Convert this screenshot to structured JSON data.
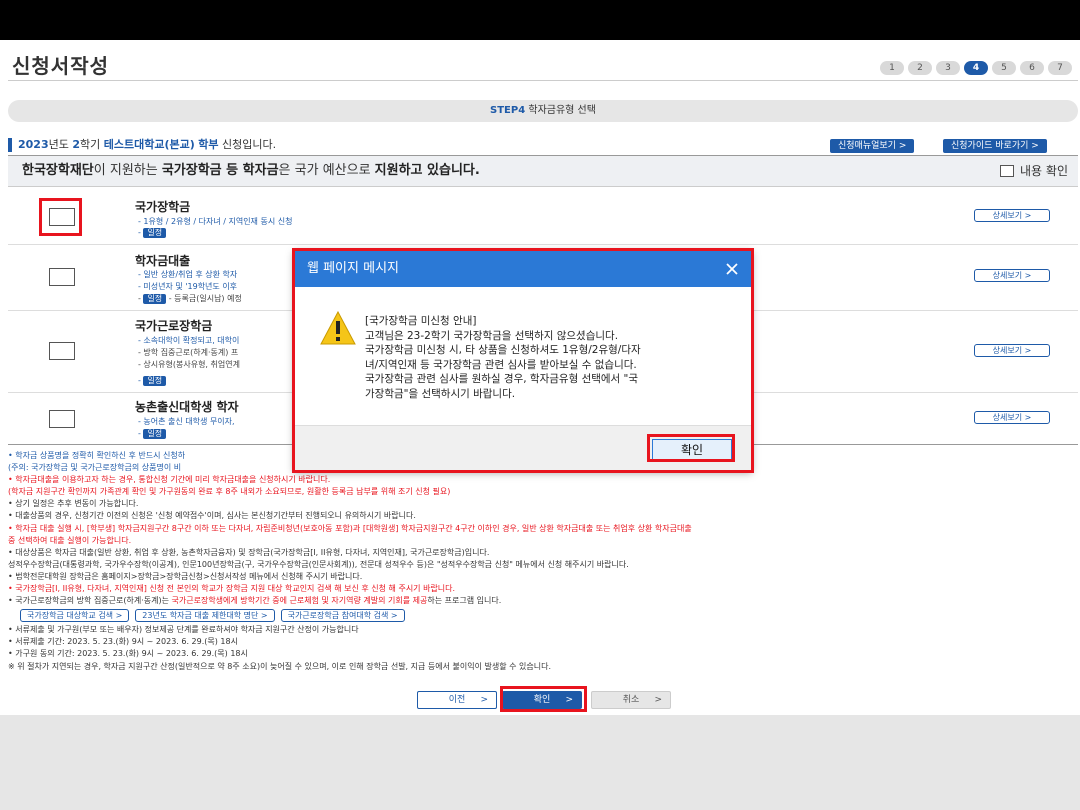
{
  "page": {
    "title": "신청서작성",
    "steps": [
      "1",
      "2",
      "3",
      "4",
      "5",
      "6",
      "7"
    ],
    "active_step": "4",
    "step_bar": {
      "step": "STEP4",
      "label": "학자금유형 선택"
    }
  },
  "school_line": {
    "year": "2023",
    "year_suffix": "년도",
    "semester": "2",
    "semester_suffix": "학기",
    "school": "테스트대학교(본교)",
    "degree": "학부",
    "suffix": "신청입니다."
  },
  "top_buttons": {
    "manual": "신청매뉴얼보기 >",
    "guide": "신청가이드 바로가기 >"
  },
  "notice": {
    "p1": "한국장학재단",
    "p2": "이 지원하는 ",
    "p3": "국가장학금 등 학자금",
    "p4": "은 국가 예산으로 ",
    "p5": "지원하고 있습니다.",
    "check_label": "내용 확인"
  },
  "rows": [
    {
      "title": "국가장학금",
      "sub1": "- 1유형 / 2유형 / 다자녀 / 지역인재 동시 신청",
      "badge": "일정",
      "detail": "상세보기 >"
    },
    {
      "title": "학자금대출",
      "sub1": "- 일반 상환/취업 후 상환 학자",
      "sub2": "- 미성년자 및 '19학년도 이후",
      "badge": "일정",
      "sub3": "- 등록금(일시납) 예정",
      "detail": "상세보기 >"
    },
    {
      "title": "국가근로장학금",
      "sub1": "- 소속대학이 확정되고, 대학이",
      "sub2": "- 방학 집중근로(하계·동계) 프",
      "sub3": "- 상시유형(봉사유형, 취업연계",
      "badge": "일정",
      "detail": "상세보기 >"
    },
    {
      "title": "농촌출신대학생 학자",
      "sub1": "- 농어촌 출신 대학생 무이자,",
      "badge": "일정",
      "detail": "상세보기 >"
    }
  ],
  "notes": {
    "n1": "• 학자금 상품명을 정확히 확인하신 후 반드시 신청하",
    "n2": "(주의: 국가장학금 및 국가근로장학금의 상품명이 비",
    "n3": "• 학자금대출을 이용하고자 하는 경우, 통합신청 기간에 미리 학자금대출을 신청하시기 바랍니다.",
    "n4": "(학자금 지원구간 확인까지 가족관계 확인 및 가구원동의 완료 후 8주 내외가 소요되므로, 원활한 등록금 납부를 위해 조기 신청 필요)",
    "n5": "• 상기 일정은 추후 변동이 가능합니다.",
    "n6": "• 대출상품의 경우, 신청기간 이전의 신청은 '신청 예약접수'이며, 심사는 본신청기간부터 진행되오니 유의하시기 바랍니다.",
    "n7": "• 학자금 대출 실행 시, [학부생] 학자금지원구간 8구간 이하 또는 다자녀, 자립준비청년(보호아동 포함)과 [대학원생] 학자금지원구간 4구간 이하인 경우, 일반 상환 학자금대출 또는 취업후 상환 학자금대출",
    "n8": "중 선택하여 대출 실행이 가능합니다.",
    "n9": "• 대상상품은 학자금 대출(일반 상환, 취업 후 상환, 농촌학자금융자) 및 장학금(국가장학금[I, II유형, 다자녀, 지역인재], 국가근로장학금)입니다.",
    "n10": "성적우수장학금(대통령과학, 국가우수장학(이공계), 인문100년장학금(구, 국가우수장학금(인문사회계)), 전문대 성적우수 등)은 \"성적우수장학금 신청\" 메뉴에서 신청 해주시기 바랍니다.",
    "n11": "• 법학전문대학원 장학금은 홈페이지>장학금>장학금신청>신청서작성 메뉴에서 신청해 주시기 바랍니다.",
    "n12": "• 국가장학금[I, II유형, 다자녀, 지역인재] 신청 전 본인의 학교가 장학금 지원 대상 학교인지 검색 해 보신 후 신청 해 주시기 바랍니다.",
    "n13_a": "• 국가근로장학금의 방학 집중근로(하계·동계)는 ",
    "n13_b": "국가근로장학생에게 방학기간 중에 근로체험 및 자기역량 계발의 기회를 제공",
    "n13_c": "하는 프로그램 입니다.",
    "links": [
      "국가장학금 대상학교 검색 >",
      "23년도 학자금 대출 제한대학 명단 >",
      "국가근로장학금 참여대학 검색 >"
    ],
    "n14": "• 서류제출 및 가구원(부모 또는 배우자) 정보제공 단계를 완료하셔야 학자금 지원구간 산정이 가능합니다",
    "n15": "• 서류제출 기간: 2023. 5. 23.(화) 9시 ~ 2023. 6. 29.(목) 18시",
    "n16": "• 가구원 동의 기간: 2023. 5. 23.(화) 9시 ~ 2023. 6. 29.(목) 18시",
    "n17": "※ 위 절차가 지연되는 경우, 학자금 지원구간 산정(일반적으로 약 8주 소요)이 늦어질 수 있으며, 이로 인해 장학금 선발, 지급 등에서 불이익이 발생할 수 있습니다."
  },
  "bottom": {
    "prev": "이전",
    "ok": "확인",
    "cancel": "취소",
    "arrow": ">"
  },
  "dialog": {
    "title": "웹 페이지 메시지",
    "lines": [
      "[국가장학금 미신청 안내]",
      "고객님은 23-2학기 국가장학금을 선택하지 않으셨습니다.",
      "국가장학금 미신청 시, 타 상품을 신청하셔도 1유형/2유형/다자",
      "녀/지역인재 등 국가장학금 관련 심사를 받아보실 수 없습니다.",
      "국가장학금 관련 심사를 원하실 경우, 학자금유형 선택에서 \"국",
      "가장학금\"을 선택하시기 바랍니다."
    ],
    "ok": "확인"
  },
  "colors": {
    "primary": "#1e5aa8",
    "dialog_blue": "#2b79d6",
    "highlight": "#e8141e"
  }
}
